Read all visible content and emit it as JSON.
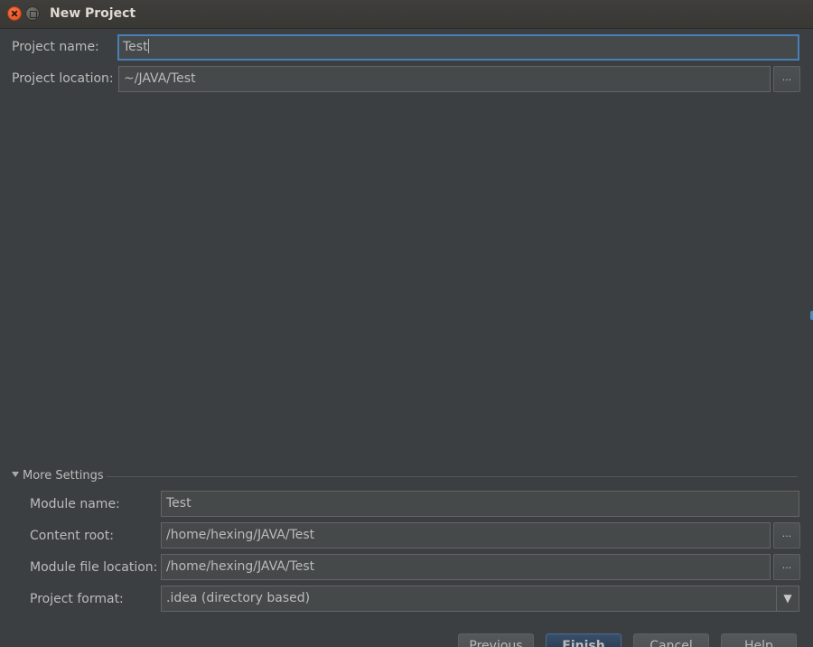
{
  "window": {
    "title": "New Project"
  },
  "project": {
    "name_label": "Project name:",
    "name_value": "Test",
    "location_label": "Project location:",
    "location_value": "~/JAVA/Test",
    "browse_label": "..."
  },
  "more_settings": {
    "header": "More Settings",
    "expanded": true,
    "module_name_label": "Module name:",
    "module_name_value": "Test",
    "content_root_label": "Content root:",
    "content_root_value": "/home/hexing/JAVA/Test",
    "module_file_location_label": "Module file location:",
    "module_file_location_value": "/home/hexing/JAVA/Test",
    "project_format_label": "Project format:",
    "project_format_value": ".idea (directory based)",
    "browse_label": "..."
  },
  "buttons": {
    "previous": "Previous",
    "finish": "Finish",
    "cancel": "Cancel",
    "help": "Help"
  },
  "colors": {
    "background": "#3c3f41",
    "field_background": "#45494a",
    "focus_border": "#4a7fb5",
    "text": "#bbbbbb",
    "close_button": "#df4a17"
  },
  "icons": {
    "close": "close-icon",
    "maximize": "maximize-icon",
    "expand": "triangle-down-icon",
    "dropdown": "dropdown-arrow-icon"
  }
}
